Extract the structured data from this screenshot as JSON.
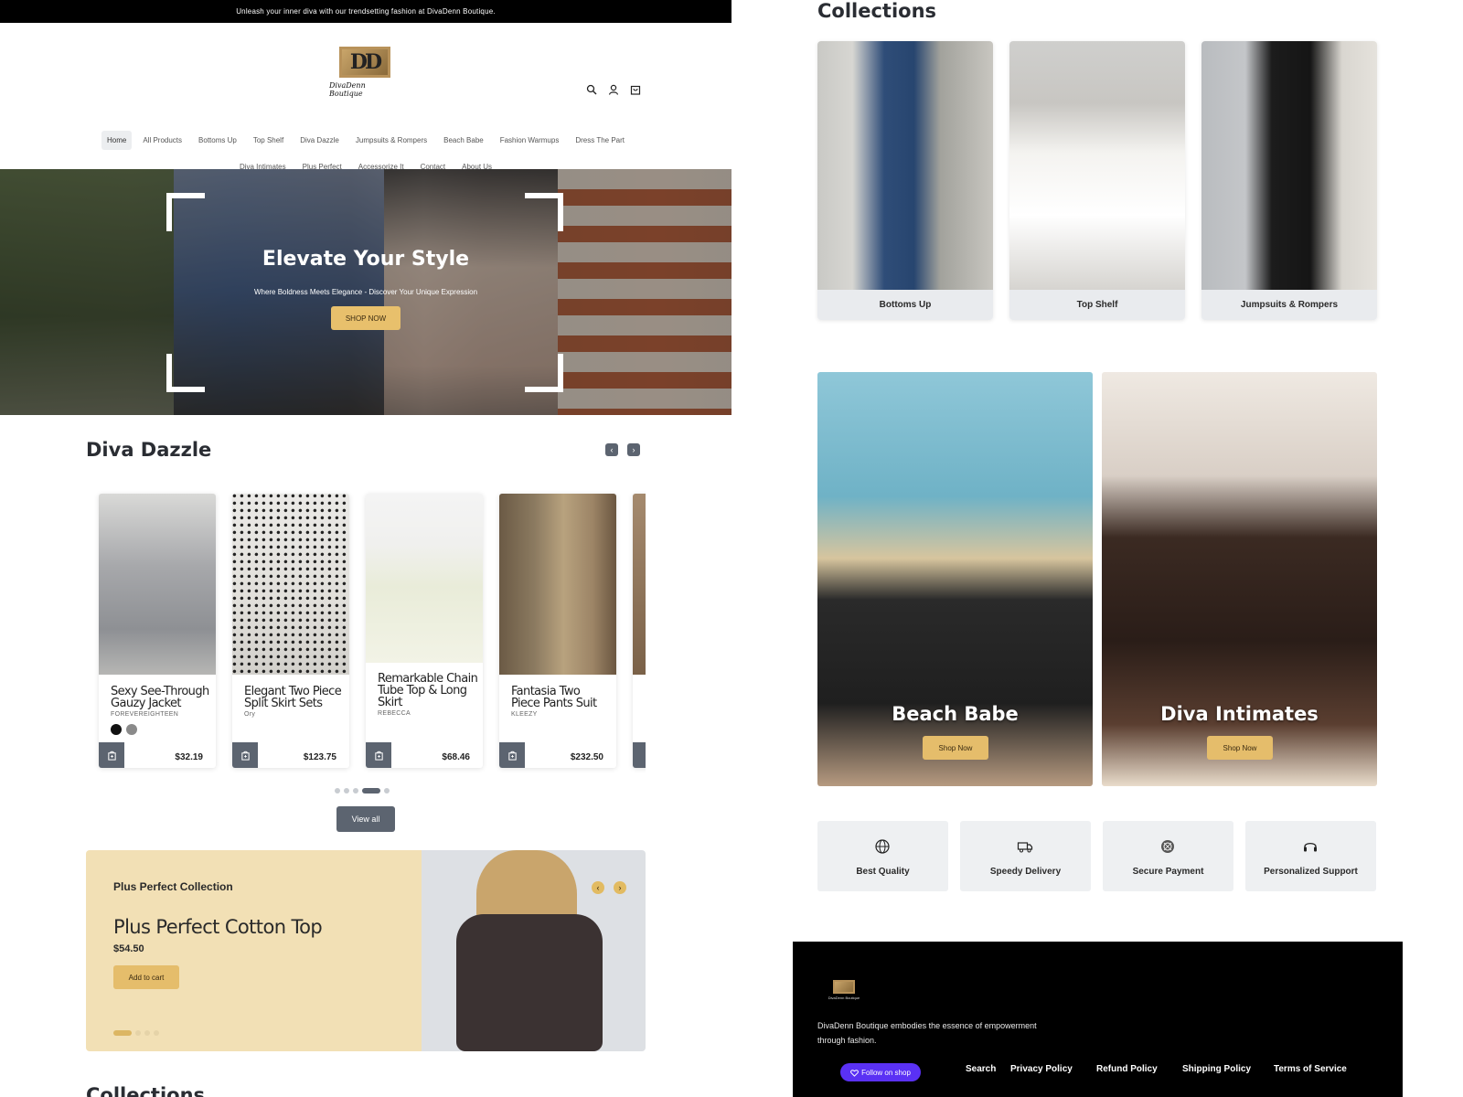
{
  "announcement": "Unleash your inner diva with our trendsetting fashion at DivaDenn Boutique.",
  "logo": {
    "mark": "DD",
    "text": "DivaDenn Boutique"
  },
  "header_icons": [
    "search-icon",
    "account-icon",
    "cart-icon"
  ],
  "nav": {
    "row1": [
      "Home",
      "All Products",
      "Bottoms Up",
      "Top Shelf",
      "Diva Dazzle",
      "Jumpsuits & Rompers",
      "Beach Babe",
      "Fashion Warmups",
      "Dress The Part"
    ],
    "row2": [
      "Diva Intimates",
      "Plus Perfect",
      "Accessorize It",
      "Contact",
      "About Us"
    ],
    "active": "Home"
  },
  "hero": {
    "title": "Elevate Your Style",
    "subtitle": "Where Boldness Meets Elegance - Discover Your Unique Expression",
    "button": "SHOP NOW"
  },
  "diva_dazzle": {
    "title": "Diva Dazzle",
    "products": [
      {
        "name": "Sexy See-Through Gauzy Jacket",
        "brand": "FOREVEREIGHTEEN",
        "price": "$32.19",
        "swatches": [
          "#111111",
          "#8a8a8a"
        ]
      },
      {
        "name": "Elegant Two Piece Split Skirt Sets",
        "brand": "Ory",
        "price": "$123.75"
      },
      {
        "name": "Remarkable Chain Tube Top & Long Skirt",
        "brand": "REBECCA",
        "price": "$68.46"
      },
      {
        "name": "Fantasia Two Piece Pants Suit",
        "brand": "KLEEZY",
        "price": "$232.50"
      }
    ],
    "view_all": "View all",
    "page_count": 5,
    "active_page": 4
  },
  "plus_perfect": {
    "eyebrow": "Plus Perfect Collection",
    "title": "Plus Perfect Cotton Top",
    "price": "$54.50",
    "button": "Add to cart",
    "slide_count": 4,
    "active_slide": 1
  },
  "collections": {
    "title": "Collections",
    "cut_title": "Collections",
    "items": [
      "Bottoms Up",
      "Top Shelf",
      "Jumpsuits & Rompers"
    ]
  },
  "featured": [
    {
      "title": "Beach Babe",
      "button": "Shop Now"
    },
    {
      "title": "Diva Intimates",
      "button": "Shop Now"
    }
  ],
  "perks": [
    {
      "label": "Best Quality",
      "icon": "globe-icon"
    },
    {
      "label": "Speedy Delivery",
      "icon": "truck-icon"
    },
    {
      "label": "Secure Payment",
      "icon": "secure-payment-icon"
    },
    {
      "label": "Personalized Support",
      "icon": "headset-icon"
    }
  ],
  "footer": {
    "description": "DivaDenn Boutique embodies the essence of empowerment through fashion.",
    "follow_button": "Follow on shop",
    "links": [
      "Search",
      "Privacy Policy",
      "Refund Policy",
      "Shipping Policy",
      "Terms of Service"
    ]
  },
  "colors": {
    "accent_gold": "#e5bd6b",
    "slate": "#5c6470",
    "cream": "#f2e0b5",
    "shop_purple": "#5a31f4"
  }
}
